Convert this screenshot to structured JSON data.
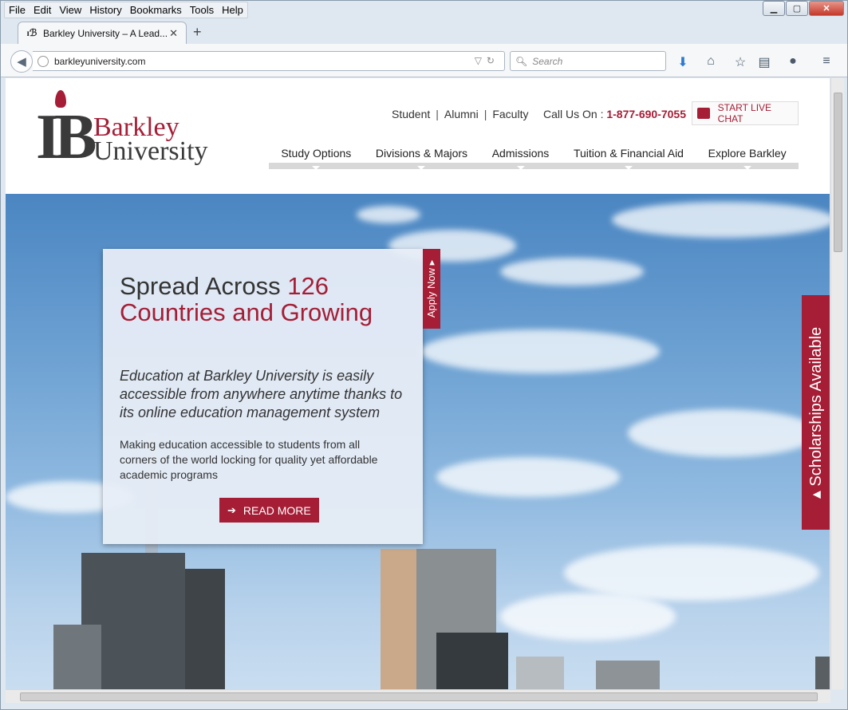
{
  "browser": {
    "menu": [
      "File",
      "Edit",
      "View",
      "History",
      "Bookmarks",
      "Tools",
      "Help"
    ],
    "tab_title": "Barkley University – A Lead...",
    "url": "barkleyuniversity.com",
    "search_placeholder": "Search"
  },
  "site": {
    "logo_line1": "Barkley",
    "logo_line2": "University",
    "logo_mark": "IB",
    "top_links": [
      "Student",
      "Alumni",
      "Faculty"
    ],
    "call_label": "Call Us On :",
    "phone": "1-877-690-7055",
    "chat_label": "START LIVE CHAT",
    "nav": [
      "Study Options",
      "Divisions & Majors",
      "Admissions",
      "Tuition & Financial Aid",
      "Explore Barkley"
    ]
  },
  "hero": {
    "title_plain": "Spread Across",
    "title_accent_1": "126",
    "title_accent_2": "Countries and Growing",
    "lead": "Education at Barkley University is easily accessible from anywhere anytime thanks to its online education management system",
    "body": "Making education accessible to students from all corners of the world locking for quality yet affordable academic programs",
    "cta": "READ MORE",
    "apply_tab": "Apply Now ▸",
    "scholarships_tab": "▴ Scholarships Available"
  },
  "colors": {
    "brand_red": "#a51e36",
    "text_dark": "#333333"
  }
}
